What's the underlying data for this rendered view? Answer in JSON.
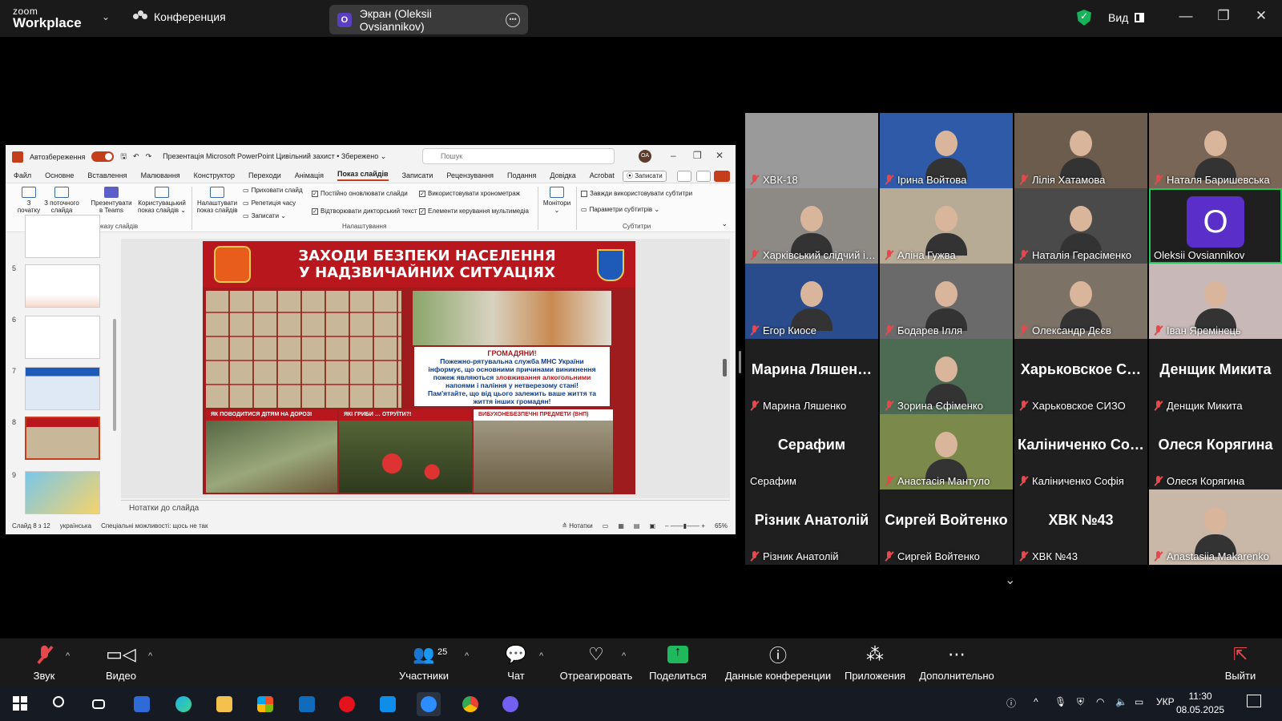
{
  "window": {
    "app_name_small": "zoom",
    "app_name": "Workplace",
    "conference_label": "Конференция",
    "share_label": "Экран (Oleksii Ovsiannikov)",
    "share_avatar": "O",
    "view_label": "Вид",
    "controls": [
      "—",
      "❐",
      "✕"
    ]
  },
  "powerpoint": {
    "autosave_label": "Автозбереження",
    "doc_title": "Презентація Microsoft PowerPoint Цивільний захист • Збережено ⌄",
    "search_placeholder": "Пошук",
    "user_initials": "OA",
    "tabs": [
      "Файл",
      "Основне",
      "Вставлення",
      "Малювання",
      "Конструктор",
      "Переходи",
      "Анімація",
      "Показ слайдів",
      "Записати",
      "Рецензування",
      "Подання",
      "Довідка",
      "Acrobat"
    ],
    "active_tab": "Показ слайдів",
    "record_button": "⦿ Записати",
    "ribbon": {
      "from_start": "З\nпочатку",
      "from_current": "З поточного\nслайда",
      "present_teams": "Презентувати\nв Teams",
      "custom_show": "Користувацький\nпоказ слайдів ⌄",
      "group_start": "Початок показу слайдів",
      "setup_show": "Налаштувати\nпоказ слайдів",
      "hide_slide": "Приховати слайд",
      "rehearse": "Репетиція часу",
      "record": "Записати ⌄",
      "keep_updated": "Постійно оновлювати слайди",
      "use_timings": "Використовувати хронометраж",
      "play_narrations": "Відтворювати дикторський текст",
      "media_controls": "Елементи керування мультимедіа",
      "group_setup": "Налаштування",
      "monitors": "Монітори ⌄",
      "always_subtitles": "Завжди використовувати субтитри",
      "subtitle_settings": "Параметри субтитрів ⌄",
      "group_subtitles": "Субтитри"
    },
    "thumb_numbers": [
      "5",
      "6",
      "7",
      "8",
      "9"
    ],
    "selected_slide": "8",
    "slide": {
      "title_line1": "ЗАХОДИ БЕЗПЕКИ НАСЕЛЕННЯ",
      "title_line2": "У НАДЗВИЧАЙНИХ СИТУАЦІЯХ",
      "notice_head": "ГРОМАДЯНИ!",
      "notice_l1": "Пожежно-рятувальна служба МНС України",
      "notice_l2": "інформує, що основними причинами виникнення",
      "notice_l3": "пожеж являються",
      "notice_red": "зловживання алкогольними",
      "notice_l4": "напоями і паління у нетверезому стані!",
      "notice_l5": "Пам'ятайте, що від цього залежить ваше життя та",
      "notice_l6": "життя інших громадян!",
      "panel_road": "ЯК ПОВОДИТИСЯ ДІТЯМ НА ДОРОЗІ",
      "panel_mush": "ЯКІ ГРИБИ … ОТРУЇТИ?!",
      "panel_explosive": "ВИБУХОНЕБЕЗПЕЧНІ ПРЕДМЕТИ (ВНП)"
    },
    "notes_label": "Нотатки до слайда",
    "status": {
      "slide_count": "Слайд 8 з 12",
      "language": "українська",
      "accessibility": "Спеціальні можливості: щось не так",
      "notes_btn": "≙ Нотатки",
      "zoom": "65%"
    }
  },
  "participants": [
    {
      "name": "ХВК-18",
      "kind": "blank",
      "bg": "#9a9a9a"
    },
    {
      "name": "Ірина Войтова",
      "kind": "photo",
      "bg": "#2e5aa8"
    },
    {
      "name": "Лілія Хатамова",
      "kind": "photo",
      "bg": "#6b5c4e"
    },
    {
      "name": "Наталя Баришевська",
      "kind": "photo",
      "bg": "#7a6656"
    },
    {
      "name": "Харківський слідчий і…",
      "kind": "photo",
      "bg": "#8d8a86"
    },
    {
      "name": "Аліна Гужва",
      "kind": "photo",
      "bg": "#b8ab96"
    },
    {
      "name": "Наталія Герасіменко",
      "kind": "photo",
      "bg": "#4a4a4a"
    },
    {
      "name": "Oleksii Ovsiannikov",
      "kind": "avatar",
      "avatar": "O",
      "speaking": true,
      "muted": false
    },
    {
      "name": "Егор Киосе",
      "kind": "photo",
      "bg": "#2a4b8c"
    },
    {
      "name": "Бодарев Ілля",
      "kind": "photo",
      "bg": "#6a6a6a"
    },
    {
      "name": "Олександр Дєєв",
      "kind": "photo",
      "bg": "#7d7266"
    },
    {
      "name": "Іван Яремінець",
      "kind": "photo",
      "bg": "#c8b8b8"
    },
    {
      "name": "Марина Ляшенко",
      "kind": "text",
      "big": "Марина Ляшен…"
    },
    {
      "name": "Зорина Єфіменко",
      "kind": "photo",
      "bg": "#4d6b52"
    },
    {
      "name": "Харьковское СИЗО",
      "kind": "text",
      "big": "Харьковское С…"
    },
    {
      "name": "Денщик Микита",
      "kind": "text",
      "big": "Денщик Микита"
    },
    {
      "name": "Серафим",
      "kind": "text",
      "big": "Серафим",
      "muted": false
    },
    {
      "name": "Анастасія Мантуло",
      "kind": "photo",
      "bg": "#7b8a4a"
    },
    {
      "name": "Каліниченко Софія",
      "kind": "text",
      "big": "Каліниченко Со…"
    },
    {
      "name": "Олеся Корягина",
      "kind": "text",
      "big": "Олеся Корягина"
    },
    {
      "name": "Різник Анатолій",
      "kind": "text",
      "big": "Різник Анатолій"
    },
    {
      "name": "Сиргей Войтенко",
      "kind": "text",
      "big": "Сиргей Войтенко"
    },
    {
      "name": "ХВК №43",
      "kind": "text",
      "big": "ХВК №43"
    },
    {
      "name": "Anastasiia Makarenko",
      "kind": "photo",
      "bg": "#c9b7a8"
    }
  ],
  "toolbar": {
    "audio": "Звук",
    "video": "Видео",
    "participants": "Участники",
    "participants_count": "25",
    "chat": "Чат",
    "react": "Отреагировать",
    "share": "Поделиться",
    "info": "Данные конференции",
    "apps": "Приложения",
    "more": "Дополнительно",
    "leave": "Выйти"
  },
  "taskbar": {
    "language": "УКР",
    "time": "11:30",
    "date": "08.05.2025"
  },
  "colors": {
    "accent_ppt": "#c43e1c",
    "speaking_border": "#22c55e",
    "share_green": "#1fb85d",
    "muted_red": "#e5484d"
  }
}
